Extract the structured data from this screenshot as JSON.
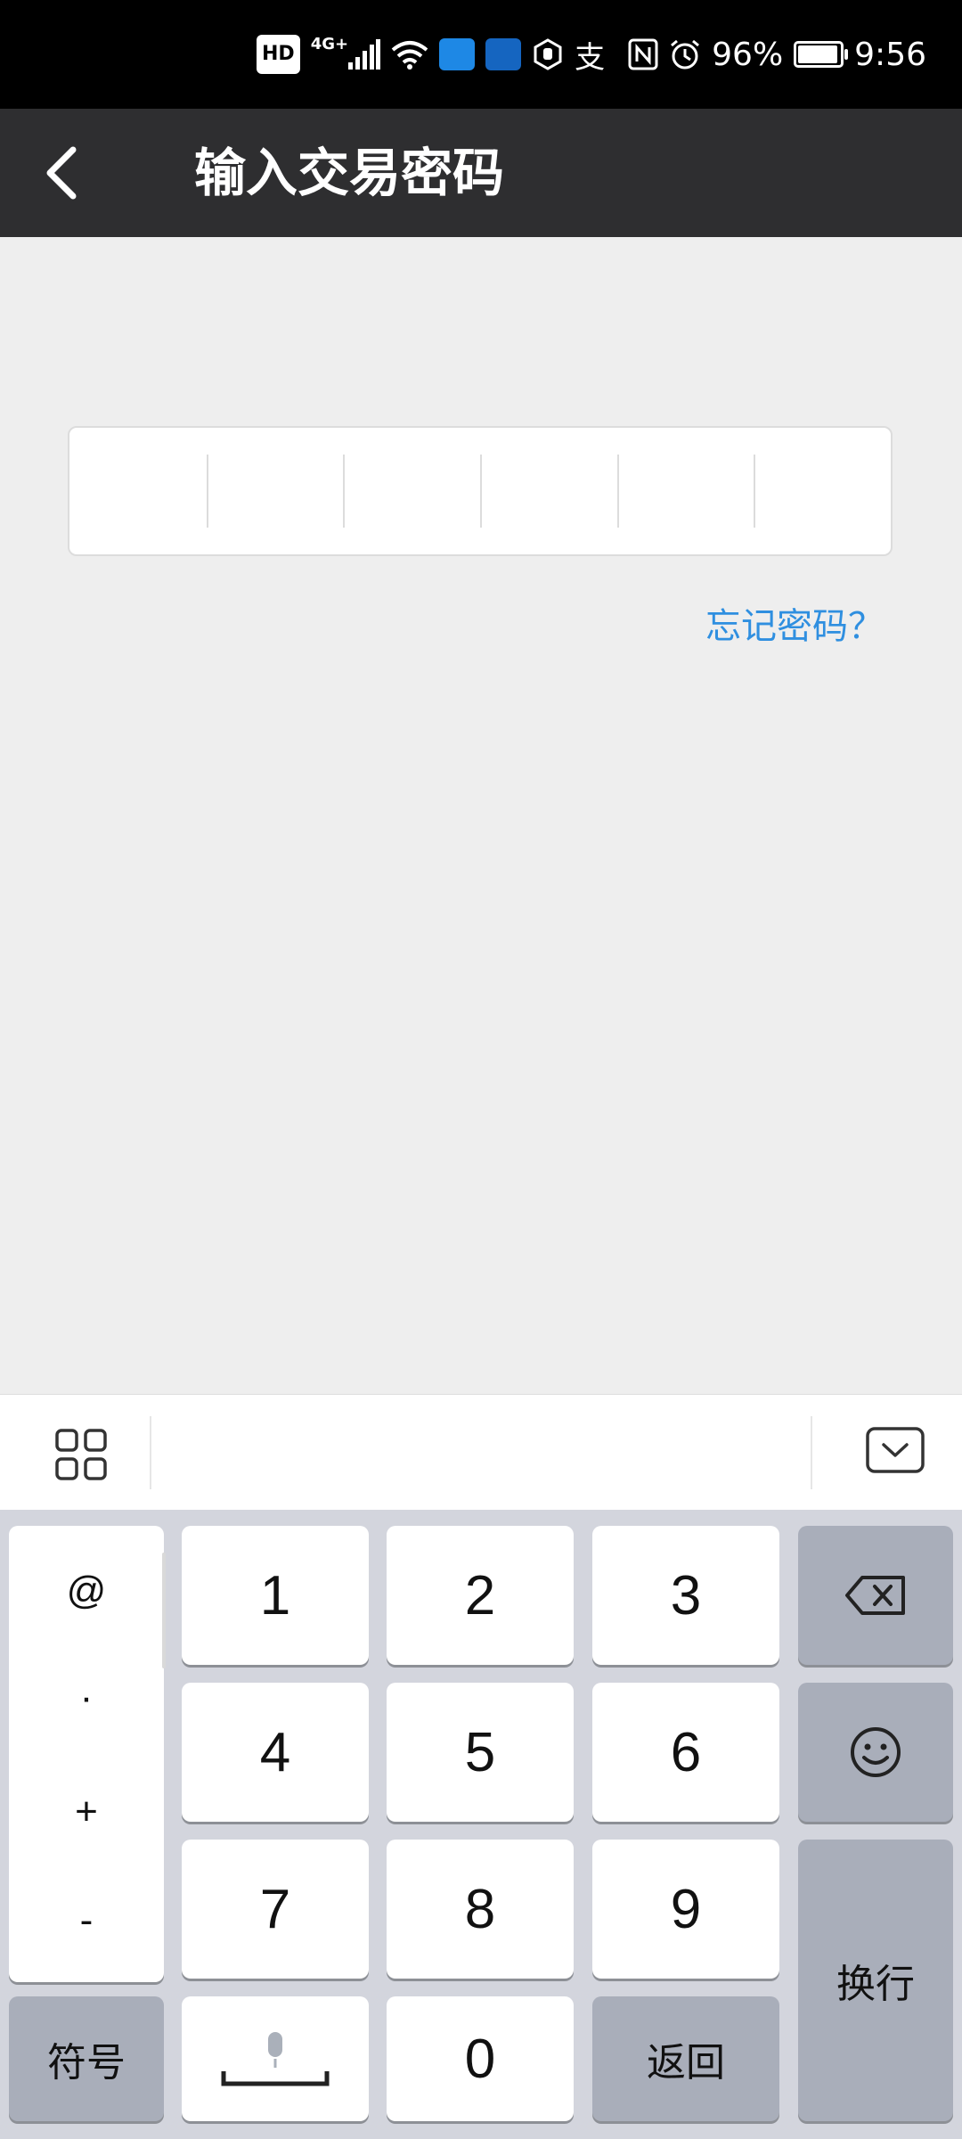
{
  "status_bar": {
    "hd": "HD",
    "network": "4G+",
    "zhi": "支",
    "battery_percent": "96%",
    "battery_level": 0.96,
    "time": "9:56"
  },
  "header": {
    "title": "输入交易密码",
    "back_icon": "chevron-left-icon"
  },
  "password": {
    "length": 6,
    "forgot_label": "忘记密码？"
  },
  "keyboard": {
    "toolbar": {
      "grid_icon": "grid-icon",
      "hide_icon": "keyboard-hide-icon"
    },
    "symbols": [
      "@",
      "·",
      "+",
      "-"
    ],
    "digits": [
      "1",
      "2",
      "3",
      "4",
      "5",
      "6",
      "7",
      "8",
      "9",
      "0"
    ],
    "symbol_key": "符号",
    "return_key": "返回",
    "newline_key": "换行",
    "backspace_icon": "backspace-icon",
    "emoji_icon": "emoji-icon",
    "mic_icon": "microphone-icon"
  },
  "colors": {
    "header_bg": "#2e2e30",
    "link": "#2f8fe0",
    "page_bg": "#eeeeee",
    "key_fn": "#a9aeba"
  }
}
